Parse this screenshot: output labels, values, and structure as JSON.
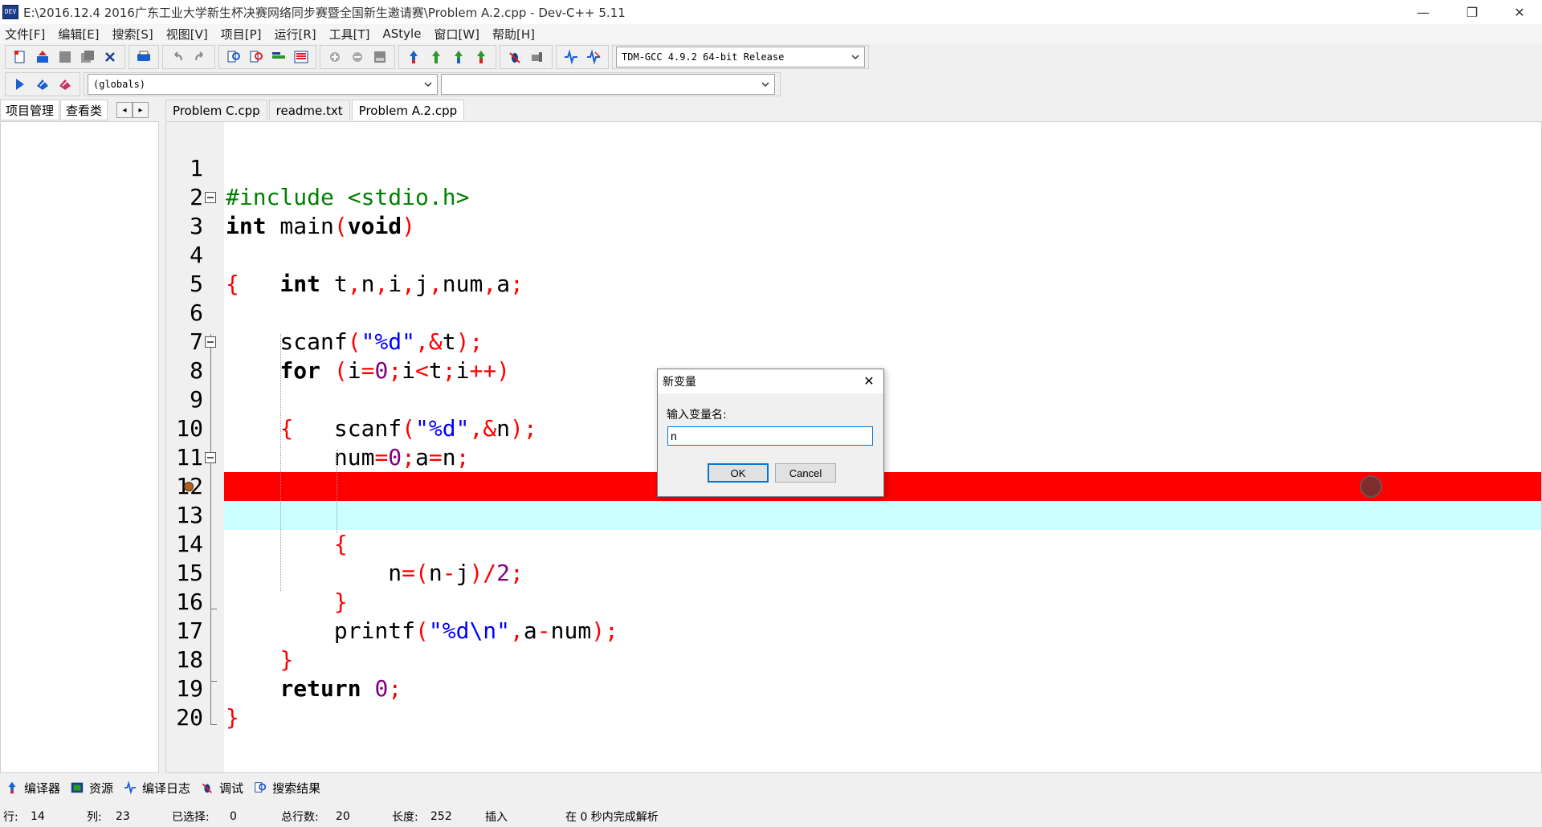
{
  "window": {
    "title": "E:\\2016.12.4 2016广东工业大学新生杯决赛网络同步赛暨全国新生邀请赛\\Problem A.2.cpp - Dev-C++ 5.11",
    "app_icon_text": "DEV",
    "minimize_glyph": "—",
    "restore_glyph": "❐",
    "close_glyph": "✕"
  },
  "menu": [
    "文件[F]",
    "编辑[E]",
    "搜索[S]",
    "视图[V]",
    "项目[P]",
    "运行[R]",
    "工具[T]",
    "AStyle",
    "窗口[W]",
    "帮助[H]"
  ],
  "toolbar": {
    "compiler_select": "TDM-GCC 4.9.2 64-bit Release",
    "scope_select": "(globals)",
    "member_select": ""
  },
  "left_tabs": [
    "项目管理",
    "查看类"
  ],
  "nav": {
    "prev": "◂",
    "next": "▸"
  },
  "file_tabs": [
    "Problem C.cpp",
    "readme.txt",
    "Problem A.2.cpp"
  ],
  "active_file_tab": "Problem A.2.cpp",
  "editor": {
    "line_numbers": [
      "1",
      "2",
      "3",
      "4",
      "5",
      "6",
      "7",
      "8",
      "9",
      "10",
      "11",
      "12",
      "13",
      "14",
      "15",
      "16",
      "17",
      "18",
      "19",
      "20"
    ],
    "highlighted_breakpoint_line": 13,
    "highlighted_current_line": 14
  },
  "bottom_tabs": [
    "编译器",
    "资源",
    "编译日志",
    "调试",
    "搜索结果"
  ],
  "status": {
    "row_label": "行:",
    "row_value": "14",
    "col_label": "列:",
    "col_value": "23",
    "sel_label": "已选择:",
    "sel_value": "0",
    "lines_label": "总行数:",
    "lines_value": "20",
    "len_label": "长度:",
    "len_value": "252",
    "mode": "插入",
    "parse_msg": "在 0 秒内完成解析"
  },
  "dialog": {
    "title": "新变量",
    "close_glyph": "✕",
    "prompt": "输入变量名:",
    "input_value": "n",
    "ok_label": "OK",
    "cancel_label": "Cancel"
  },
  "colors": {
    "breakpoint_line": "#ff0000",
    "current_line": "#ccffff",
    "preprocessor": "#008000",
    "symbol": "#ff0000",
    "string": "#0000ff",
    "number": "#800080"
  }
}
